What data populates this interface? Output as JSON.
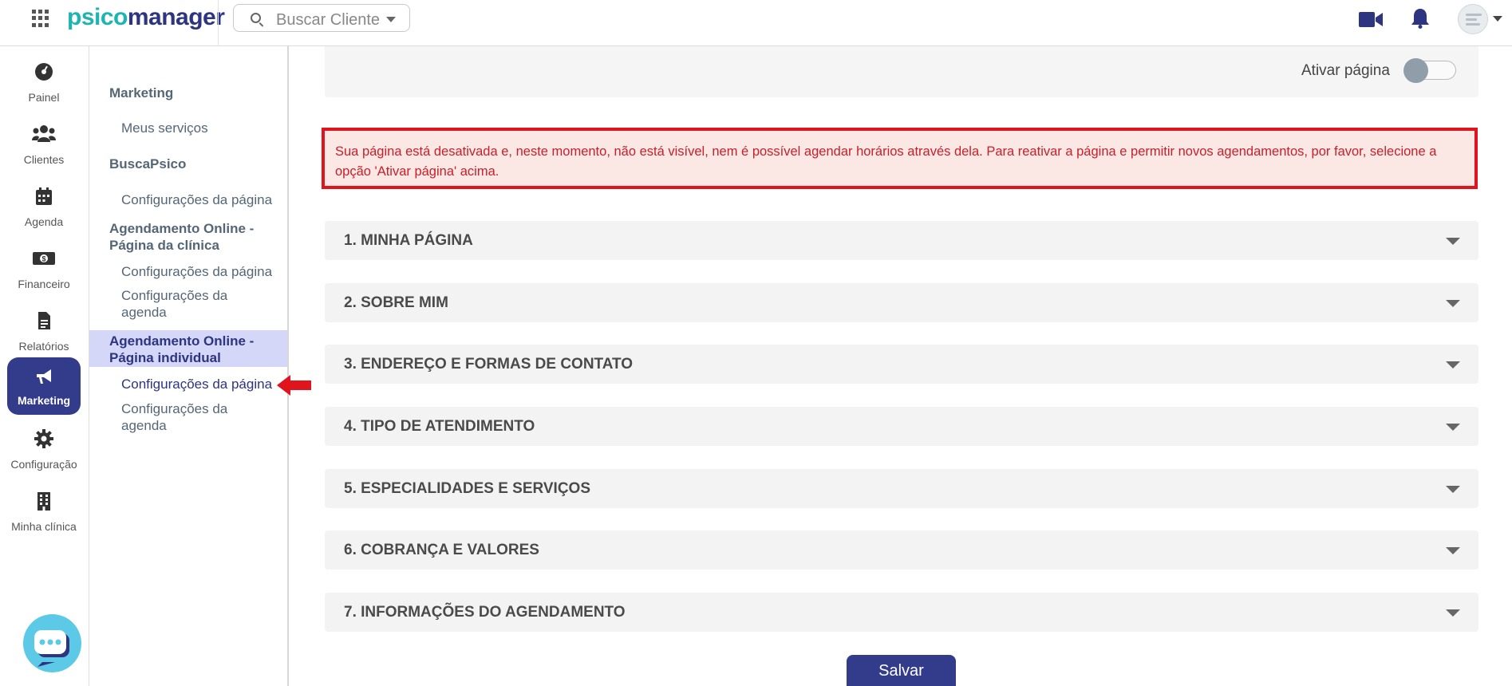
{
  "header": {
    "logo_part1": "psico",
    "logo_part2": "manager",
    "search_placeholder": "Buscar Cliente",
    "icons": [
      "apps-grid-icon",
      "search-icon",
      "video-icon",
      "bell-icon",
      "avatar"
    ]
  },
  "rail": {
    "items": [
      {
        "label": "Painel",
        "icon": "dashboard-icon"
      },
      {
        "label": "Clientes",
        "icon": "users-icon"
      },
      {
        "label": "Agenda",
        "icon": "calendar-icon"
      },
      {
        "label": "Financeiro",
        "icon": "money-icon"
      },
      {
        "label": "Relatórios",
        "icon": "document-icon"
      },
      {
        "label": "Marketing",
        "icon": "megaphone-icon",
        "active": true
      },
      {
        "label": "Configuração",
        "icon": "gear-icon"
      },
      {
        "label": "Minha clínica",
        "icon": "building-icon"
      }
    ]
  },
  "subnav": {
    "group_marketing": "Marketing",
    "link_meus_servicos": "Meus serviços",
    "group_buscapsico": "BuscaPsico",
    "link_buscapsico_config": "Configurações da página",
    "group_clinica_line1": "Agendamento Online -",
    "group_clinica_line2": "Página da clínica",
    "link_clinica_config_pagina": "Configurações da página",
    "link_clinica_config_agenda_line1": "Configurações da",
    "link_clinica_config_agenda_line2": "agenda",
    "group_individual_line1": "Agendamento Online -",
    "group_individual_line2": "Página individual",
    "link_individual_config_pagina": "Configurações da página",
    "link_individual_config_agenda_line1": "Configurações da",
    "link_individual_config_agenda_line2": "agenda"
  },
  "main": {
    "toggle_label": "Ativar página",
    "toggle_on": false,
    "alert_text": "Sua página está desativada e, neste momento, não está visível, nem é possível agendar horários através dela. Para reativar a página e permitir novos agendamentos, por favor, selecione a opção 'Ativar página' acima.",
    "sections": [
      "1. MINHA PÁGINA",
      "2. SOBRE MIM",
      "3. ENDEREÇO E FORMAS DE CONTATO",
      "4. TIPO DE ATENDIMENTO",
      "5. ESPECIALIDADES E SERVIÇOS",
      "6. COBRANÇA E VALORES",
      "7. INFORMAÇÕES DO AGENDAMENTO"
    ],
    "save_label": "Salvar"
  },
  "colors": {
    "brand_teal": "#1cb5b1",
    "brand_navy": "#2d3480",
    "active_rail": "#323c8a",
    "alert_red": "#e0141c",
    "alert_bg": "#fbe7e4"
  }
}
